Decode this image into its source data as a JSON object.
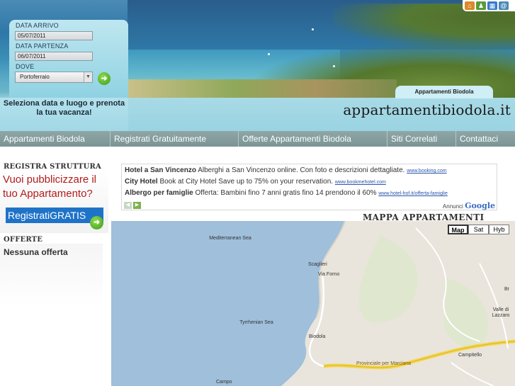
{
  "booking": {
    "arrival_label": "DATA ARRIVO",
    "arrival_value": "05/07/2011",
    "departure_label": "DATA PARTENZA",
    "departure_value": "06/07/2011",
    "where_label": "DOVE",
    "where_value": "Portoferraio"
  },
  "promo_text": "Seleziona data e luogo e prenota la tua vacanza!",
  "site_tab": "Appartamenti Biodola",
  "site_logo": "appartamentibiodola.it",
  "nav": {
    "items": [
      "Appartamenti Biodola",
      "Registrati Gratuitamente",
      "Offerte Appartamenti Biodola",
      "Siti Correlati",
      "Contattaci"
    ]
  },
  "sidebar": {
    "register_title": "REGISTRA STRUTTURA",
    "ad_text": "Vuoi pubblicizzare il tuo Appartamento?",
    "register_button": "RegistratiGRATIS",
    "offers_title": "OFFERTE",
    "no_offers": "Nessuna offerta"
  },
  "ads": [
    {
      "title": "Hotel a San Vincenzo",
      "text": "Alberghi a San Vincenzo online. Con foto e descrizioni dettagliate.",
      "url": "www.booking.com"
    },
    {
      "title": "City Hotel",
      "text": "Book at City Hotel Save up to 75% on your reservation.",
      "url": "www.bookmehotel.com"
    },
    {
      "title": "Albergo per famiglie",
      "text": "Offerta: Bambini fino 7 anni gratis fino 14 prendono il 60%",
      "url": "www.hotel-hof.it/offerta-famiglie"
    }
  ],
  "ads_label": "Annunci",
  "ads_brand": "Google",
  "map": {
    "title": "MAPPA APPARTAMENTI",
    "buttons": [
      "Map",
      "Sat",
      "Hyb"
    ],
    "active_button": "Map",
    "labels": [
      "Mediterranean Sea",
      "Scaglieri",
      "Via Forno",
      "Tyrrhenian Sea",
      "Biodola",
      "Valle di Lazzaro",
      "Campitello",
      "Campo",
      "Provinciale per Marciana",
      "Br"
    ]
  },
  "colors": {
    "nav_bg": "#8fa6a6",
    "ad_red": "#b31b1b",
    "register_blue": "#1e73c8",
    "map_water": "#9fbfdb",
    "map_land": "#e9e5dc",
    "road_yellow": "#f6d64a"
  }
}
